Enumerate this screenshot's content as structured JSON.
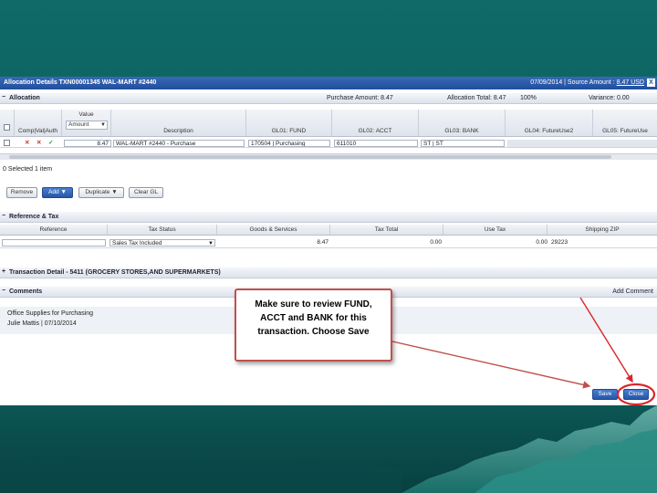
{
  "title_bar": {
    "left": "Allocation Details  TXN00001345  WAL-MART #2440",
    "date_prefix": "07/09/2014 | Source Amount : ",
    "source_amount": "8.47 USD",
    "close": "X"
  },
  "allocation": {
    "section_label": "Allocation",
    "purchase_amount": "Purchase Amount: 8.47",
    "allocation_total": "Allocation Total: 8.47",
    "percent": "100%",
    "variance": "Variance: 0.00",
    "columns": {
      "comp": "Comp|Val|Auth",
      "value_group": "Value",
      "value_select": "Amount",
      "description": "Description",
      "gl01": "GL01: FUND",
      "gl02": "GL02: ACCT",
      "gl03": "GL03: BANK",
      "gl04": "GL04: FutureUse2",
      "gl05": "GL05: FutureUse"
    },
    "row": {
      "value": "8.47",
      "description": "WAL-MART #2440 - Purchase",
      "fund": "170504 | Purchasing",
      "acct": "611010",
      "bank": "ST | ST"
    },
    "selection_status": "0 Selected  1 item",
    "buttons": {
      "remove": "Remove",
      "add": "Add",
      "duplicate": "Duplicate",
      "clear_gl": "Clear GL"
    }
  },
  "reference_tax": {
    "section_label": "Reference & Tax",
    "columns": [
      "Reference",
      "Tax Status",
      "Goods & Services",
      "Tax Total",
      "Use Tax",
      "Shipping ZIP"
    ],
    "tax_status_value": "Sales Tax Included",
    "goods_services": "8.47",
    "tax_total": "0.00",
    "use_tax": "0.00",
    "shipping_zip": "29223"
  },
  "transaction_detail": {
    "section_label": "Transaction Detail - 5411 (GROCERY STORES,AND SUPERMARKETS)"
  },
  "comments": {
    "section_label": "Comments",
    "add_comment": "Add Comment",
    "text": "Office Supplies for Purchasing",
    "author": "Julie Mattis | 07/10/2014"
  },
  "footer_buttons": {
    "save": "Save",
    "close": "Close"
  },
  "callout": {
    "line1": "Make sure to review FUND,",
    "line2": "ACCT and BANK for this",
    "line3": "transaction.  Choose Save"
  },
  "colors": {
    "accent_red": "#c0504d",
    "annotation_red": "#d9262b",
    "title_blue": "#1f4f9c",
    "slide_teal": "#0d5f5e"
  }
}
